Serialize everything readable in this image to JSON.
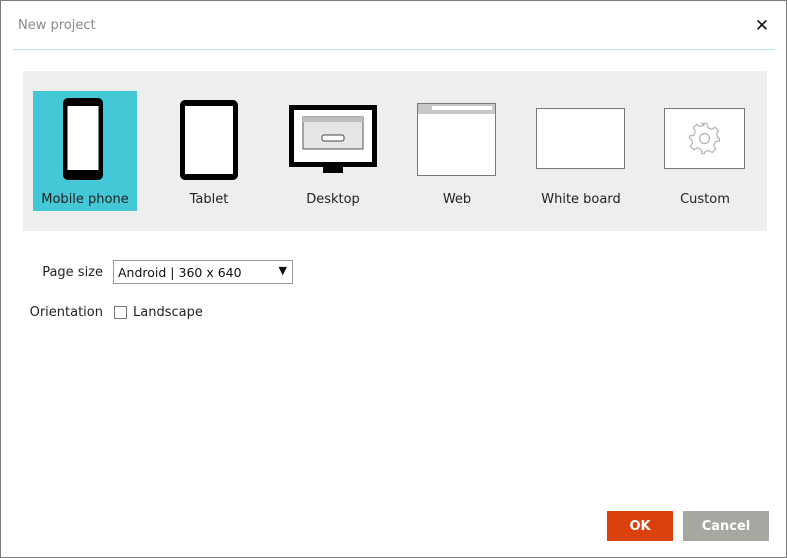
{
  "dialog": {
    "title": "New project",
    "close_symbol": "✕"
  },
  "project_types": {
    "selected": "Mobile phone",
    "items": [
      {
        "label": "Mobile phone",
        "icon": "mobile-phone-icon"
      },
      {
        "label": "Tablet",
        "icon": "tablet-icon"
      },
      {
        "label": "Desktop",
        "icon": "desktop-monitor-icon"
      },
      {
        "label": "Web",
        "icon": "web-browser-icon"
      },
      {
        "label": "White board",
        "icon": "whiteboard-icon"
      },
      {
        "label": "Custom",
        "icon": "gear-icon"
      }
    ]
  },
  "page_size": {
    "label": "Page size",
    "value": "Android | 360 x 640",
    "arrow": "▼"
  },
  "orientation": {
    "label": "Orientation",
    "checkbox_label": "Landscape",
    "checked": false
  },
  "buttons": {
    "ok": "OK",
    "cancel": "Cancel"
  },
  "colors": {
    "accent_selected": "#44c7d6",
    "ok_button": "#d9410f",
    "cancel_button": "#a7a7a1",
    "panel_bg": "#eeeeee"
  }
}
